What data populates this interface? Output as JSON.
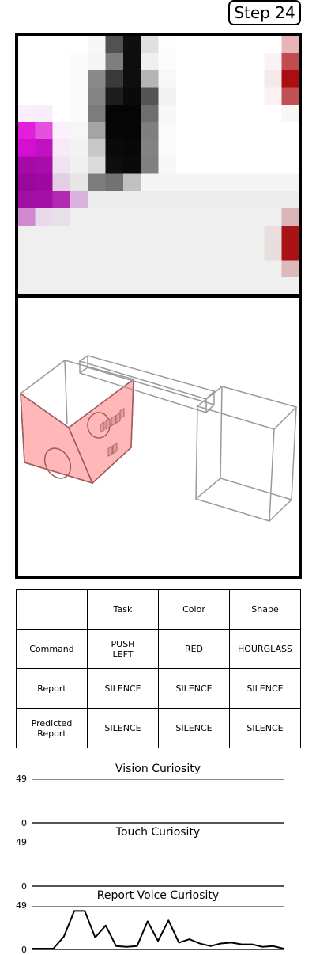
{
  "step": {
    "label": "Step 24"
  },
  "vision": {
    "rows": 15,
    "cols": 16,
    "cells": [
      [
        "#ffffff",
        "#ffffff",
        "#ffffff",
        "#ffffff",
        "#f7f7f7",
        "#525252",
        "#0f0f0f",
        "#e0e0e0",
        "#fdfdfd",
        "#ffffff",
        "#ffffff",
        "#ffffff",
        "#ffffff",
        "#ffffff",
        "#ffffff",
        "#e8b4b6"
      ],
      [
        "#ffffff",
        "#ffffff",
        "#ffffff",
        "#fbfbfb",
        "#f5f5f5",
        "#7e7e7e",
        "#0e0e0e",
        "#efefef",
        "#fcfcfc",
        "#ffffff",
        "#ffffff",
        "#ffffff",
        "#ffffff",
        "#ffffff",
        "#fbf3f3",
        "#bf4d4f"
      ],
      [
        "#ffffff",
        "#ffffff",
        "#ffffff",
        "#fbfbfb",
        "#898989",
        "#3a3a3a",
        "#0e0e0e",
        "#b5b5b5",
        "#f8f8f8",
        "#ffffff",
        "#ffffff",
        "#ffffff",
        "#ffffff",
        "#ffffff",
        "#f5e8e8",
        "#a90e10"
      ],
      [
        "#ffffff",
        "#ffffff",
        "#ffffff",
        "#fbfbfb",
        "#848484",
        "#1d1d1d",
        "#0a0a0a",
        "#555555",
        "#f2f2f2",
        "#ffffff",
        "#ffffff",
        "#ffffff",
        "#ffffff",
        "#ffffff",
        "#fbf3f3",
        "#bf5154"
      ],
      [
        "#f9eefb",
        "#f8eefb",
        "#ffffff",
        "#fafafa",
        "#7c7c7c",
        "#050505",
        "#050505",
        "#6e6e6e",
        "#f7f7f7",
        "#ffffff",
        "#ffffff",
        "#ffffff",
        "#ffffff",
        "#ffffff",
        "#ffffff",
        "#fbf6f6"
      ],
      [
        "#e21fdd",
        "#e650df",
        "#fbf0fb",
        "#f6f6f6",
        "#a4a4a4",
        "#060606",
        "#050505",
        "#7f7f7f",
        "#fafafa",
        "#ffffff",
        "#ffffff",
        "#ffffff",
        "#ffffff",
        "#ffffff",
        "#ffffff",
        "#ffffff"
      ],
      [
        "#d60ed2",
        "#c012c0",
        "#f7eaf6",
        "#f2f2f2",
        "#c8c8c8",
        "#0a0a0a",
        "#080808",
        "#828282",
        "#fafafa",
        "#ffffff",
        "#ffffff",
        "#ffffff",
        "#ffffff",
        "#ffffff",
        "#ffffff",
        "#ffffff"
      ],
      [
        "#a40aa5",
        "#a80ca9",
        "#f1e2f1",
        "#f0f0f0",
        "#dbdbdb",
        "#0e0e0e",
        "#0a0a0a",
        "#808080",
        "#f7f7f7",
        "#ffffff",
        "#ffffff",
        "#ffffff",
        "#ffffff",
        "#ffffff",
        "#ffffff",
        "#ffffff"
      ],
      [
        "#9a089b",
        "#9e0aa0",
        "#e3cfe4",
        "#e6e6e6",
        "#7c7c7c",
        "#727272",
        "#c0c0c0",
        "#f4f4f4",
        "#f4f4f4",
        "#f4f4f4",
        "#f4f4f4",
        "#f4f4f4",
        "#f4f4f4",
        "#f4f4f4",
        "#f4f4f4",
        "#f4f4f4"
      ],
      [
        "#a210a3",
        "#a50fa6",
        "#b22ab4",
        "#d8b2dd",
        "#ececec",
        "#ececec",
        "#ececec",
        "#ececec",
        "#ececec",
        "#ececec",
        "#ececec",
        "#ececec",
        "#ececec",
        "#ececec",
        "#ececec",
        "#ececec"
      ],
      [
        "#cf89d1",
        "#e9d9ea",
        "#e8e0e9",
        "#efefef",
        "#efefef",
        "#efefef",
        "#efefef",
        "#efefef",
        "#efefef",
        "#efefef",
        "#efefef",
        "#efefef",
        "#efefef",
        "#efefef",
        "#efefef",
        "#d9b5b8"
      ],
      [
        "#efefef",
        "#efefef",
        "#efefef",
        "#efefef",
        "#efefef",
        "#efefef",
        "#efefef",
        "#efefef",
        "#efefef",
        "#efefef",
        "#efefef",
        "#efefef",
        "#efefef",
        "#efefef",
        "#e8dede",
        "#a81316"
      ],
      [
        "#efefef",
        "#efefef",
        "#efefef",
        "#efefef",
        "#efefef",
        "#efefef",
        "#efefef",
        "#efefef",
        "#efefef",
        "#efefef",
        "#efefef",
        "#efefef",
        "#efefef",
        "#efefef",
        "#e8dddd",
        "#ab1216"
      ],
      [
        "#efefef",
        "#efefef",
        "#efefef",
        "#efefef",
        "#efefef",
        "#efefef",
        "#efefef",
        "#efefef",
        "#efefef",
        "#efefef",
        "#efefef",
        "#efefef",
        "#efefef",
        "#efefef",
        "#efefef",
        "#deb9ba"
      ],
      [
        "#efefef",
        "#efefef",
        "#efefef",
        "#efefef",
        "#efefef",
        "#efefef",
        "#efefef",
        "#efefef",
        "#efefef",
        "#efefef",
        "#efefef",
        "#efefef",
        "#efefef",
        "#efefef",
        "#efefef",
        "#efefef"
      ]
    ]
  },
  "touch": {
    "box_fill": "#ff9999",
    "wire_color": "#9a9a9a"
  },
  "table": {
    "header": [
      "",
      "Task",
      "Color",
      "Shape"
    ],
    "rows": [
      {
        "label": "Command",
        "cells": [
          "PUSH\nLEFT",
          "RED",
          "HOURGLASS"
        ]
      },
      {
        "label": "Report",
        "cells": [
          "SILENCE",
          "SILENCE",
          "SILENCE"
        ]
      },
      {
        "label": "Predicted\nReport",
        "cells": [
          "SILENCE",
          "SILENCE",
          "SILENCE"
        ]
      }
    ]
  },
  "chart_data": [
    {
      "type": "line",
      "title": "Vision Curiosity",
      "ylim": [
        0,
        49
      ],
      "yticks": [
        "49",
        "0"
      ],
      "values": []
    },
    {
      "type": "line",
      "title": "Touch Curiosity",
      "ylim": [
        0,
        49
      ],
      "yticks": [
        "49",
        "0"
      ],
      "values": []
    },
    {
      "type": "line",
      "title": "Report Voice Curiosity",
      "ylim": [
        0,
        49
      ],
      "yticks": [
        "49",
        "0"
      ],
      "values": [
        0,
        0,
        0,
        14,
        44,
        44,
        13,
        27,
        3,
        2,
        3,
        32,
        9,
        33,
        7,
        11,
        6,
        3,
        6,
        7,
        5,
        5,
        2,
        3,
        0
      ]
    }
  ]
}
